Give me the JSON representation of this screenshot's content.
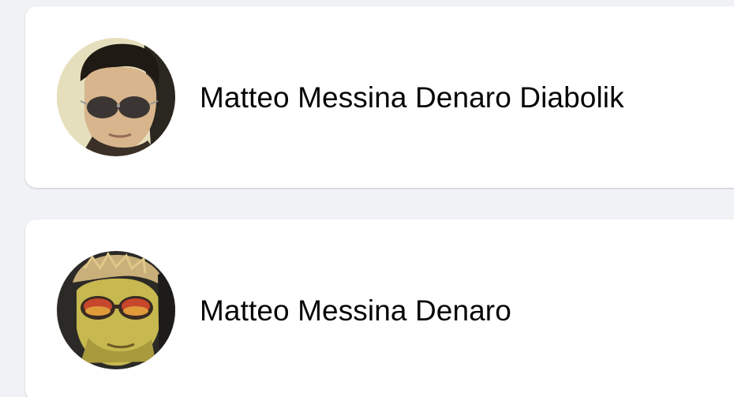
{
  "profiles": [
    {
      "name": "Matteo Messina Denaro Diabolik",
      "avatar": "profile-photo-sunglasses"
    },
    {
      "name": "Matteo Messina Denaro",
      "avatar": "profile-painting-crown-sunglasses"
    }
  ],
  "colors": {
    "page_background": "#f0f2f5",
    "card_background": "#ffffff",
    "text": "#050505"
  }
}
